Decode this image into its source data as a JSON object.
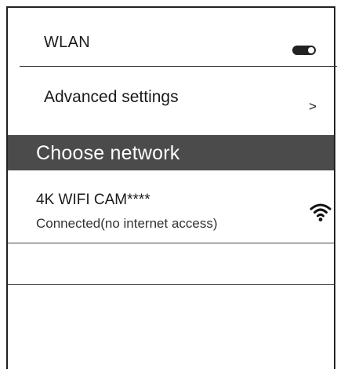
{
  "wlan": {
    "label": "WLAN",
    "enabled": true
  },
  "advanced": {
    "label": "Advanced settings",
    "chevron": ">"
  },
  "section": {
    "title": "Choose network"
  },
  "networks": [
    {
      "name": "4K WIFI CAM****",
      "status": "Connected(no internet access)",
      "icon": "wifi-icon"
    }
  ]
}
